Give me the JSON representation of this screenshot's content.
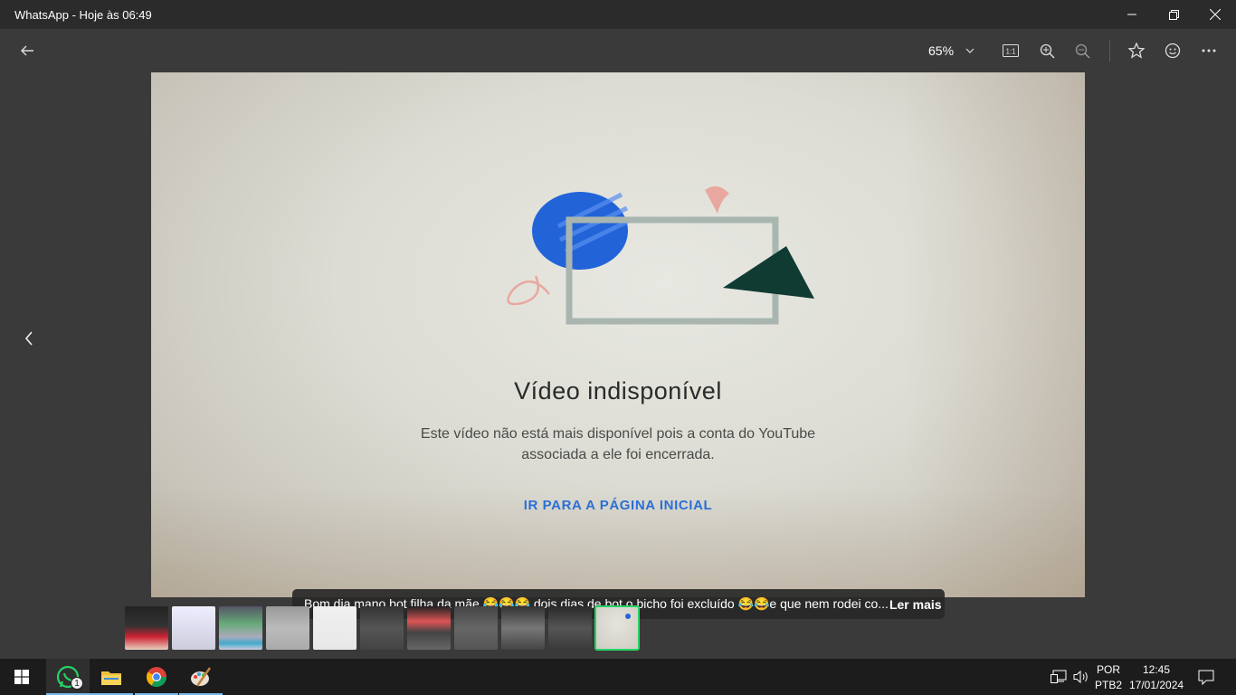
{
  "window": {
    "title": "WhatsApp - Hoje às 06:49"
  },
  "toolbar": {
    "zoom_level": "65%",
    "icons": [
      "back-arrow-icon",
      "chevron-down-icon",
      "actual-size-icon",
      "zoom-in-icon",
      "zoom-out-icon",
      "star-icon",
      "emoji-icon",
      "more-icon"
    ]
  },
  "photo": {
    "title": "Vídeo indisponível",
    "description_line1": "Este vídeo não está mais disponível pois a conta do YouTube",
    "description_line2": "associada a ele foi encerrada.",
    "link": "IR PARA A PÁGINA INICIAL",
    "colors": {
      "blue_circle": "#2264d8",
      "dark_triangle": "#0f3b33",
      "pink": "#e8a8a0",
      "frame": "#a9b6b0"
    }
  },
  "caption": {
    "text": "Bom dia mano bot filha da mãe 😂😂😂 dois dias de bot o bicho foi excluído 😂😂e que nem rodei co...",
    "more_label": "Ler mais"
  },
  "filmstrip": {
    "count": 11,
    "selected_index": 10,
    "accent": "#25d366"
  },
  "taskbar": {
    "apps": [
      "windows-start-icon",
      "whatsapp-icon",
      "file-explorer-icon",
      "chrome-icon",
      "paint-icon"
    ],
    "whatsapp_badge": "1",
    "lang_line1": "POR",
    "lang_line2": "PTB2",
    "time": "12:45",
    "date": "17/01/2024"
  }
}
